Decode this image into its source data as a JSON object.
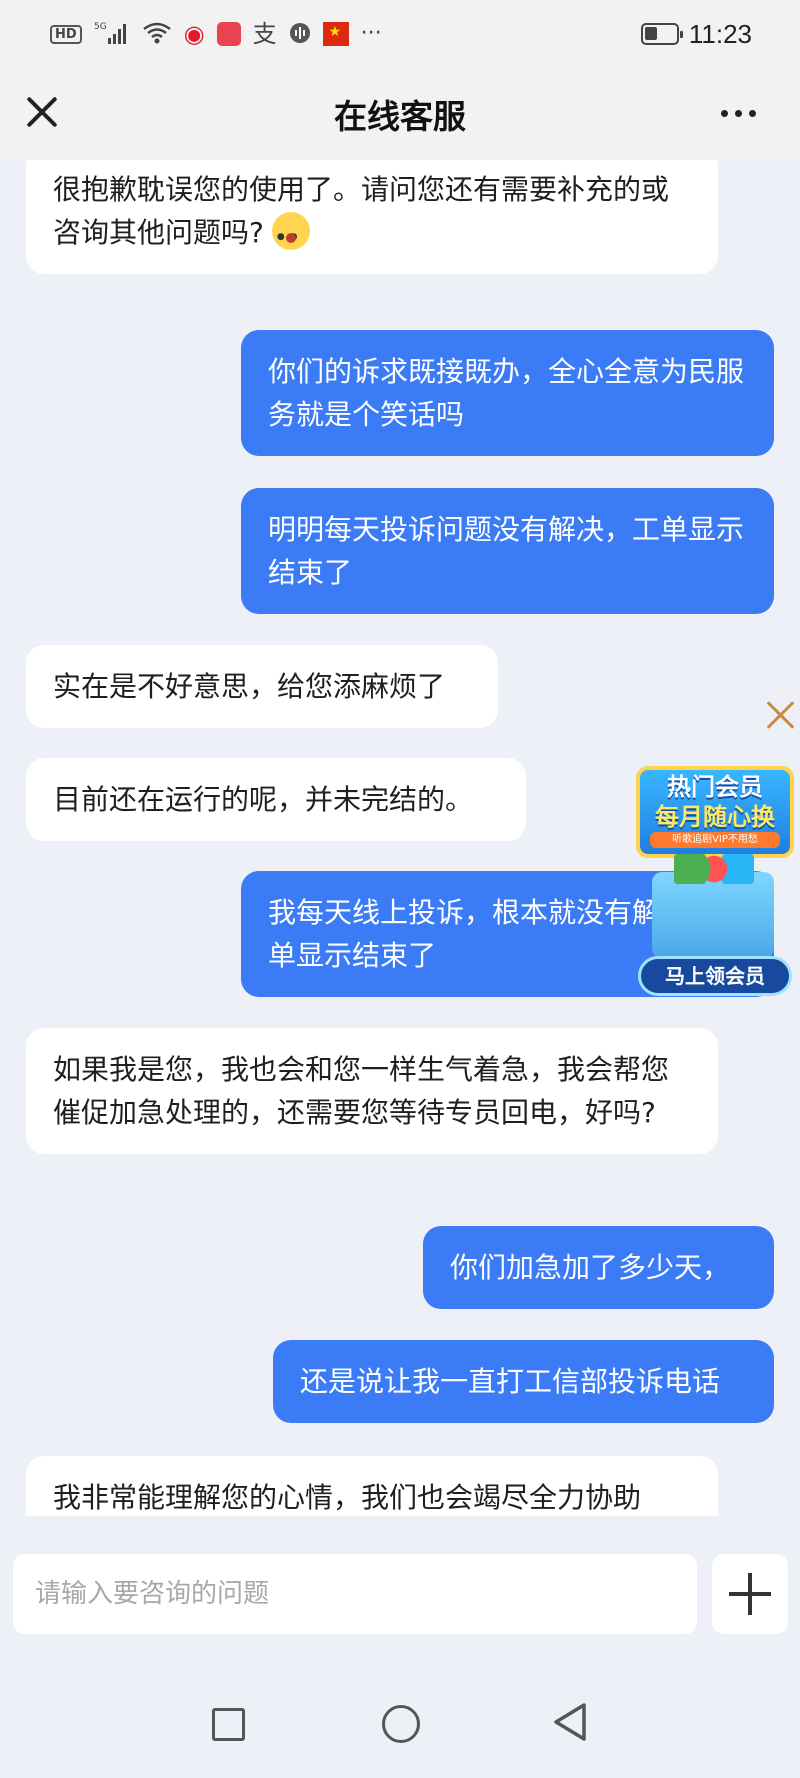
{
  "status_bar": {
    "hd": "HD",
    "signal": "5G",
    "time": "11:23",
    "more": "···",
    "icons": [
      "hd-icon",
      "signal-icon",
      "wifi-icon",
      "weibo-icon",
      "notification-app-icon",
      "alipay-icon",
      "voice-icon",
      "flag-icon",
      "more-icon",
      "battery-icon"
    ]
  },
  "header": {
    "title": "在线客服"
  },
  "messages": [
    {
      "from": "agent",
      "text": "很抱歉耽误您的使用了。请问您还有需要补充的或咨询其他问题吗?",
      "emoji": "surprised-face"
    },
    {
      "from": "user",
      "text": "你们的诉求既接既办，全心全意为民服务就是个笑话吗"
    },
    {
      "from": "user",
      "text": "明明每天投诉问题没有解决，工单显示结束了"
    },
    {
      "from": "agent",
      "text": "实在是不好意思，给您添麻烦了"
    },
    {
      "from": "agent",
      "text": "目前还在运行的呢，并未完结的。"
    },
    {
      "from": "user",
      "text": "我每天线上投诉，根本就没有解决，工单显示结束了"
    },
    {
      "from": "agent",
      "text": "如果我是您，我也会和您一样生气着急，我会帮您催促加急处理的，还需要您等待专员回电，好吗?"
    },
    {
      "from": "user",
      "text": "你们加急加了多少天，"
    },
    {
      "from": "user",
      "text": "还是说让我一直打工信部投诉电话"
    },
    {
      "from": "agent",
      "text": "我非常能理解您的心情，我们也会竭尽全力协助"
    }
  ],
  "promo": {
    "line1": "热门会员",
    "line2": "每月随心换",
    "line3": "听歌追剧VIP不用愁",
    "button": "马上领会员"
  },
  "input": {
    "placeholder": "请输入要咨询的问题",
    "value": ""
  },
  "colors": {
    "user_bubble": "#3b7bf6",
    "agent_bubble": "#ffffff",
    "background": "#eef0f7"
  }
}
